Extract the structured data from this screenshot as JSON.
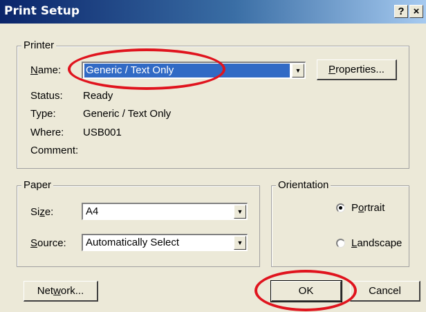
{
  "window": {
    "title": "Print Setup",
    "help_glyph": "?",
    "close_glyph": "×"
  },
  "printer": {
    "legend": "Printer",
    "name_label": [
      "",
      "N",
      "ame:"
    ],
    "name_value": "Generic / Text Only",
    "properties_label": [
      "",
      "P",
      "roperties..."
    ],
    "status_label": "Status:",
    "status_value": "Ready",
    "type_label": "Type:",
    "type_value": "Generic / Text Only",
    "where_label": "Where:",
    "where_value": "USB001",
    "comment_label": "Comment:"
  },
  "paper": {
    "legend": "Paper",
    "size_label": [
      "Si",
      "z",
      "e:"
    ],
    "size_value": "A4",
    "source_label": [
      "",
      "S",
      "ource:"
    ],
    "source_value": "Automatically Select"
  },
  "orientation": {
    "legend": "Orientation",
    "portrait_label": [
      "P",
      "o",
      "rtrait"
    ],
    "landscape_label": [
      "",
      "L",
      "andscape"
    ],
    "selected": "portrait"
  },
  "buttons": {
    "network_label": [
      "Net",
      "w",
      "ork..."
    ],
    "ok_label": "OK",
    "cancel_label": "Cancel"
  },
  "annotation_color": "#e0141e",
  "icons": {
    "dropdown": "chevron-down-icon",
    "radio_dot": "radio-dot-icon"
  }
}
